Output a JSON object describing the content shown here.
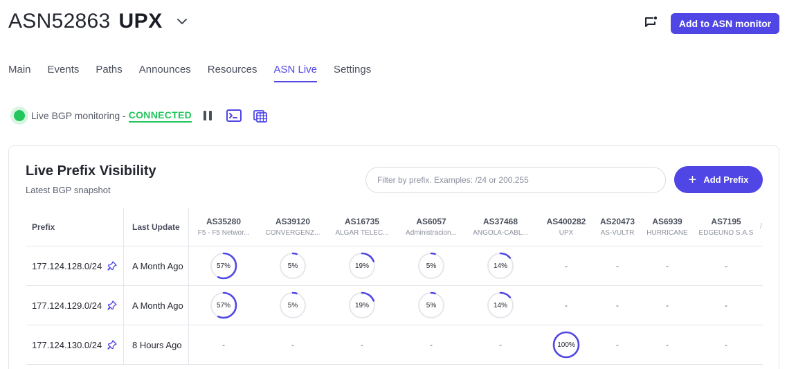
{
  "header": {
    "asn": "ASN52863",
    "name": "UPX",
    "add_button": "Add to ASN monitor"
  },
  "tabs": [
    {
      "label": "Main",
      "active": false
    },
    {
      "label": "Events",
      "active": false
    },
    {
      "label": "Paths",
      "active": false
    },
    {
      "label": "Announces",
      "active": false
    },
    {
      "label": "Resources",
      "active": false
    },
    {
      "label": "ASN Live",
      "active": true
    },
    {
      "label": "Settings",
      "active": false
    }
  ],
  "live": {
    "text": "Live BGP monitoring -",
    "status": "CONNECTED",
    "status_color": "#22c55e"
  },
  "card": {
    "title": "Live Prefix Visibility",
    "subtitle": "Latest BGP snapshot",
    "filter_placeholder": "Filter by prefix. Examples: /24 or 200.255",
    "add_prefix_label": "Add Prefix"
  },
  "table": {
    "col_prefix": "Prefix",
    "col_update": "Last Update",
    "asns": [
      {
        "num": "AS35280",
        "name": "F5 - F5 Networ..."
      },
      {
        "num": "AS39120",
        "name": "CONVERGENZ..."
      },
      {
        "num": "AS16735",
        "name": "ALGAR TELEC..."
      },
      {
        "num": "AS6057",
        "name": "Administracion..."
      },
      {
        "num": "AS37468",
        "name": "ANGOLA-CABL..."
      },
      {
        "num": "AS400282",
        "name": "UPX"
      },
      {
        "num": "AS20473",
        "name": "AS-VULTR"
      },
      {
        "num": "AS6939",
        "name": "HURRICANE"
      },
      {
        "num": "AS7195",
        "name": "EDGEUNO S.A.S"
      }
    ],
    "rows": [
      {
        "prefix": "177.124.128.0/24",
        "update": "A Month Ago",
        "cells": [
          {
            "pct": 57,
            "label": "57%"
          },
          {
            "pct": 5,
            "label": "5%"
          },
          {
            "pct": 19,
            "label": "19%"
          },
          {
            "pct": 5,
            "label": "5%"
          },
          {
            "pct": 14,
            "label": "14%"
          },
          {
            "label": "-"
          },
          {
            "label": "-"
          },
          {
            "label": "-"
          },
          {
            "label": "-"
          }
        ]
      },
      {
        "prefix": "177.124.129.0/24",
        "update": "A Month Ago",
        "cells": [
          {
            "pct": 57,
            "label": "57%"
          },
          {
            "pct": 5,
            "label": "5%"
          },
          {
            "pct": 19,
            "label": "19%"
          },
          {
            "pct": 5,
            "label": "5%"
          },
          {
            "pct": 14,
            "label": "14%"
          },
          {
            "label": "-"
          },
          {
            "label": "-"
          },
          {
            "label": "-"
          },
          {
            "label": "-"
          }
        ]
      },
      {
        "prefix": "177.124.130.0/24",
        "update": "8 Hours Ago",
        "cells": [
          {
            "label": "-"
          },
          {
            "label": "-"
          },
          {
            "label": "-"
          },
          {
            "label": "-"
          },
          {
            "label": "-"
          },
          {
            "pct": 100,
            "label": "100%"
          },
          {
            "label": "-"
          },
          {
            "label": "-"
          },
          {
            "label": "-"
          }
        ]
      }
    ]
  },
  "colors": {
    "accent": "#4f46e5",
    "ring_track": "#e5e7eb"
  }
}
